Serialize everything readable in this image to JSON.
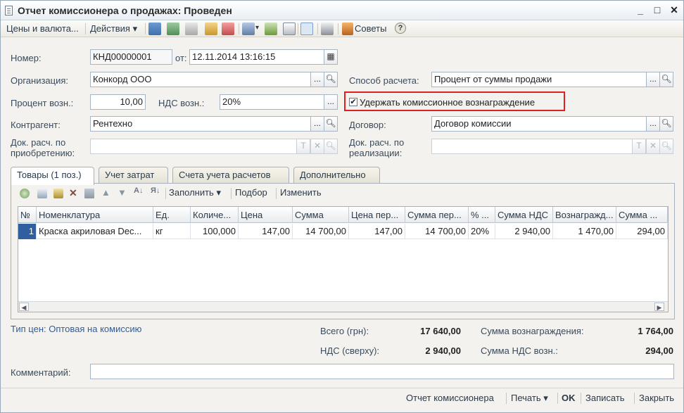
{
  "window": {
    "title": "Отчет комиссионера о продажах: Проведен",
    "minimize": "_",
    "maximize": "□",
    "close": "✕"
  },
  "toolbar": {
    "prices_currency": "Цены и валюта...",
    "actions": "Действия",
    "dropdown_arrow": "▾",
    "tips": "Советы",
    "help": "?"
  },
  "form": {
    "number_label": "Номер:",
    "number_value": "КНД00000001",
    "date_label": "от:",
    "date_value": "12.11.2014 13:16:15",
    "org_label": "Организация:",
    "org_value": "Конкорд ООО",
    "calc_method_label": "Способ расчета:",
    "calc_method_value": "Процент от суммы продажи",
    "percent_label": "Процент возн.:",
    "percent_value": "10,00",
    "vat_label": "НДС возн.:",
    "vat_value": "20%",
    "withhold_label": "Удержать комиссионное вознаграждение",
    "withhold_checked": "✔",
    "counterparty_label": "Контрагент:",
    "counterparty_value": "Рентехно",
    "contract_label": "Договор:",
    "contract_value": "Договор комиссии",
    "doc_purchase_label_1": "Док. расч. по",
    "doc_purchase_label_2": "приобретению:",
    "doc_purchase_value": "",
    "doc_sale_label_1": "Док. расч. по",
    "doc_sale_label_2": "реализации:",
    "doc_sale_value": "",
    "btn_dots": "...",
    "btn_t": "T",
    "btn_x": "✕"
  },
  "tabs": [
    {
      "label": "Товары (1 поз.)"
    },
    {
      "label": "Учет затрат"
    },
    {
      "label": "Счета учета расчетов"
    },
    {
      "label": "Дополнительно"
    }
  ],
  "table_toolbar": {
    "fill": "Заполнить",
    "select": "Подбор",
    "change": "Изменить"
  },
  "grid": {
    "headers": [
      "№",
      "Номенклатура",
      "Ед.",
      "Количе...",
      "Цена",
      "Сумма",
      "Цена пер...",
      "Сумма пер...",
      "% ...",
      "Сумма НДС",
      "Вознагражд...",
      "Сумма ..."
    ],
    "rows": [
      [
        "1",
        "Краска акриловая Dec...",
        "кг",
        "100,000",
        "147,00",
        "14 700,00",
        "147,00",
        "14 700,00",
        "20%",
        "2 940,00",
        "1 470,00",
        "294,00"
      ]
    ]
  },
  "footer": {
    "price_type": "Тип цен: Оптовая на комиссию",
    "total_label": "Всего (грн):",
    "total_value": "17 640,00",
    "reward_label": "Сумма вознаграждения:",
    "reward_value": "1 764,00",
    "vat_label": "НДС (сверху):",
    "vat_value": "2 940,00",
    "reward_vat_label": "Сумма НДС возн.:",
    "reward_vat_value": "294,00",
    "comment_label": "Комментарий:",
    "comment_value": ""
  },
  "bottom": {
    "report": "Отчет комиссионера",
    "print": "Печать",
    "ok": "OK",
    "save": "Записать",
    "close": "Закрыть"
  }
}
